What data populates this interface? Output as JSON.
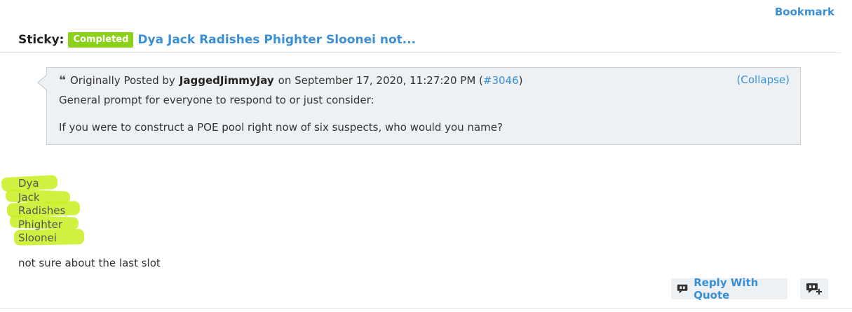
{
  "header": {
    "bookmark_label": "Bookmark",
    "sticky_label": "Sticky:",
    "badge_label": "Completed",
    "thread_title": "Dya Jack Radishes Phighter Sloonei not..."
  },
  "quote": {
    "prefix": "Originally Posted by",
    "author": "JaggedJimmyJay",
    "date_text": "on September 17, 2020, 11:27:20 PM (",
    "post_link": "#3046",
    "suffix": ")",
    "collapse_label": "(Collapse)",
    "line1": "General prompt for everyone to respond to or just consider:",
    "line2": "If you were to construct a POE pool right now of six suspects, who would you name?"
  },
  "post": {
    "names": [
      "Dya",
      "Jack",
      "Radishes",
      "Phighter",
      "Sloonei"
    ],
    "text": "not sure about the last slot"
  },
  "actions": {
    "reply_with_quote_label": "Reply With Quote"
  },
  "colors": {
    "link": "#3a8fd6",
    "badge": "#8bd119",
    "highlight": "#c8ee1e"
  }
}
